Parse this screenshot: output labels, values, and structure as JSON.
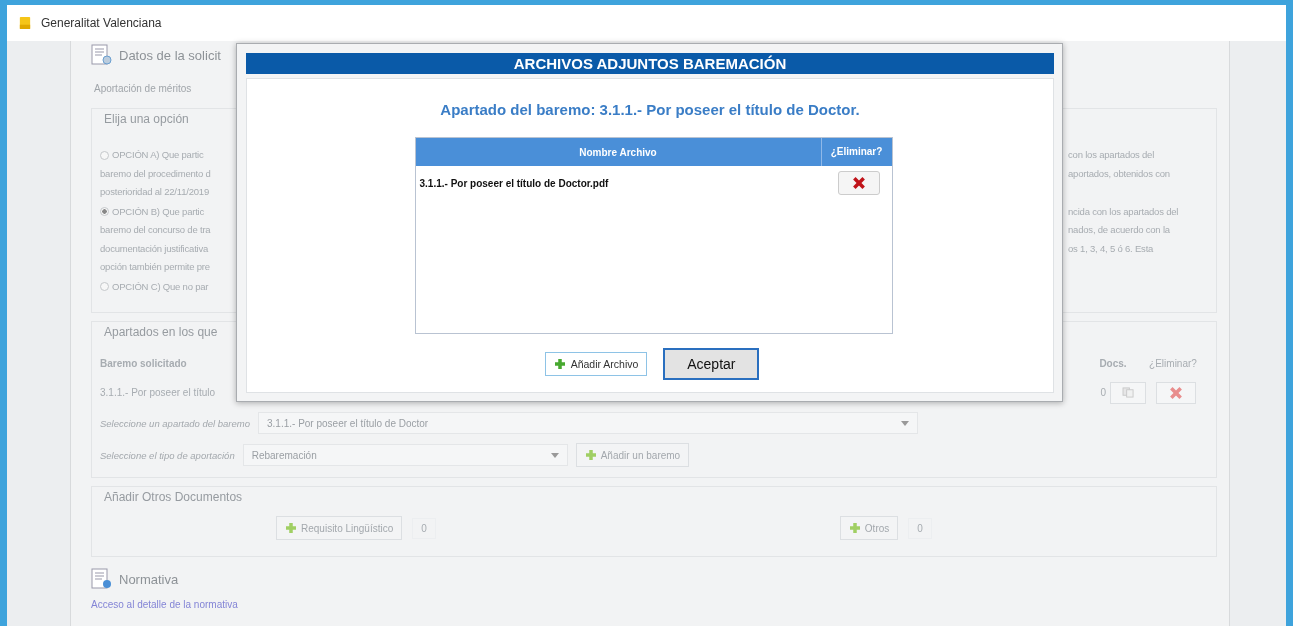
{
  "window": {
    "title": "Generalitat Valenciana"
  },
  "page": {
    "section_title": "Datos de la solicit",
    "subsection": "Aportación de méritos",
    "options_legend": "Elija una opción",
    "options": [
      {
        "selected": false,
        "left_lines": [
          "OPCIÓN A) Que partic",
          "baremo del procedimento d",
          "posterioridad al 22/11/2019"
        ],
        "right_lines": [
          "con los apartados del",
          "aportados, obtenidos con"
        ]
      },
      {
        "selected": true,
        "left_lines": [
          "OPCIÓN B) Que partic",
          "baremo del concurso de tra",
          "documentación justificativa",
          "opción también permite pre"
        ],
        "right_lines": [
          "ncida con los apartados del",
          "nados, de acuerdo con la",
          "os 1, 3, 4, 5 ó 6. Esta"
        ]
      },
      {
        "selected": false,
        "left_lines": [
          "OPCIÓN C) Que no par"
        ]
      }
    ],
    "apartados": {
      "legend": "Apartados en los que",
      "columns": [
        "Baremo solicitado",
        "Docs.",
        "¿Eliminar?"
      ],
      "rows": [
        {
          "baremo": "3.1.1.- Por poseer el título",
          "docs": "0"
        }
      ]
    },
    "select_apartado": {
      "label": "Seleccione un apartado del baremo",
      "value": "3.1.1.- Por poseer el título de Doctor"
    },
    "select_tipo": {
      "label": "Seleccione el tipo de aportación",
      "value": "Rebaremación"
    },
    "add_baremo_button": "Añadir un baremo",
    "otros": {
      "legend": "Añadir Otros Documentos",
      "buttons": [
        {
          "label": "Requisito Lingüístico",
          "count": "0"
        },
        {
          "label": "Otros",
          "count": "0"
        }
      ]
    },
    "normativa": {
      "title": "Normativa",
      "link": "Acceso al detalle de la normativa"
    }
  },
  "dialog": {
    "title": "ARCHIVOS ADJUNTOS BAREMACIÓN",
    "subtitle": "Apartado del baremo: 3.1.1.- Por poseer el título de Doctor.",
    "columns": [
      "Nombre Archivo",
      "¿Eliminar?"
    ],
    "files": [
      {
        "name": "3.1.1.- Por poseer el título de Doctor.pdf"
      }
    ],
    "buttons": [
      {
        "kind": "add",
        "label": "Añadir Archivo"
      },
      {
        "kind": "primary",
        "label": "Aceptar"
      }
    ]
  }
}
